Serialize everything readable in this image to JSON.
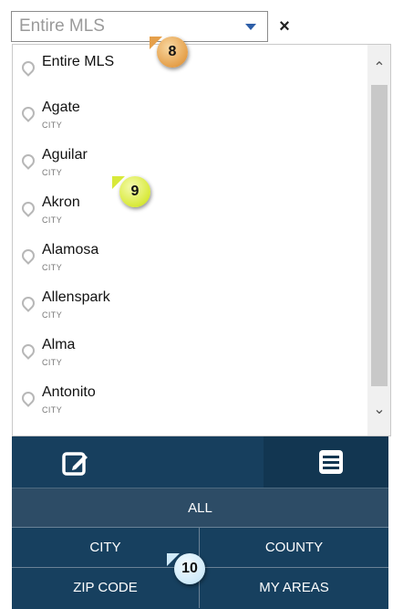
{
  "search": {
    "placeholder": "Entire MLS"
  },
  "close": {
    "label": "×"
  },
  "dropdown": {
    "items": [
      {
        "name": "Entire MLS",
        "type": ""
      },
      {
        "name": "Agate",
        "type": "CITY"
      },
      {
        "name": "Aguilar",
        "type": "CITY"
      },
      {
        "name": "Akron",
        "type": "CITY"
      },
      {
        "name": "Alamosa",
        "type": "CITY"
      },
      {
        "name": "Allenspark",
        "type": "CITY"
      },
      {
        "name": "Alma",
        "type": "CITY"
      },
      {
        "name": "Antonito",
        "type": "CITY"
      }
    ]
  },
  "toolbar": {
    "all_label": "ALL",
    "city_label": "CITY",
    "county_label": "COUNTY",
    "zip_label": "ZIP CODE",
    "myareas_label": "MY AREAS"
  },
  "badges": {
    "search_badge": "8",
    "list_badge": "9",
    "toolbar_badge": "10"
  },
  "icons": {
    "location": "map-pin-icon",
    "edit": "edit-icon",
    "list": "list-icon",
    "scroll_up": "chevron-up-icon",
    "scroll_down": "chevron-down-icon",
    "close": "close-icon",
    "dropdown_caret": "caret-down-icon"
  },
  "colors": {
    "toolbar_bg": "#17405f",
    "all_button_bg": "#2d4c66",
    "caret": "#2d5ea8"
  }
}
